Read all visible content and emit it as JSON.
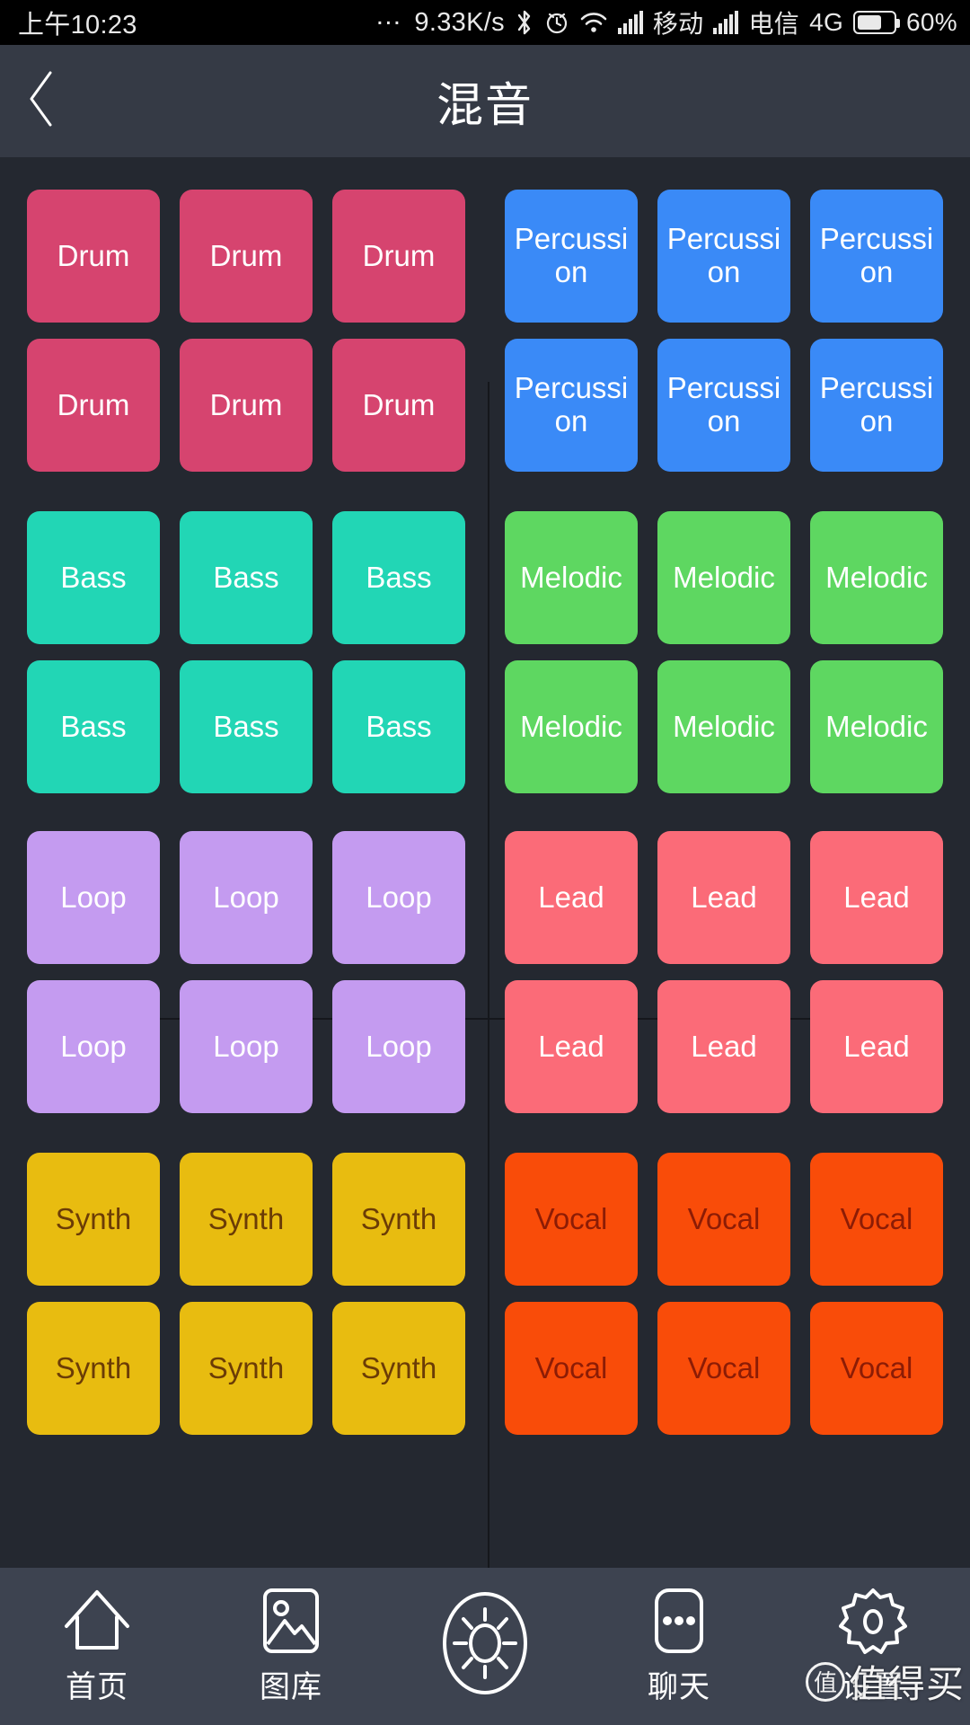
{
  "status_bar": {
    "time": "上午10:23",
    "dots": "…",
    "network_speed": "9.33K/s",
    "bluetooth_icon": "bluetooth-icon",
    "alarm_icon": "alarm-icon",
    "wifi_icon": "wifi-icon",
    "signal1_icon": "signal-bars-icon",
    "carrier1": "移动",
    "signal2_icon": "signal-bars-icon",
    "carrier2": "电信",
    "network_type": "4G",
    "battery_icon": "battery-icon",
    "battery_percent": "60%"
  },
  "title_bar": {
    "back_icon": "back-chevron-icon",
    "title": "混音"
  },
  "colors": {
    "background": "#242830",
    "title_bar": "#353A45",
    "nav_bar": "#3D4350",
    "divider": "#15171c",
    "drum": "#D6446F",
    "percussion": "#3A8AF7",
    "bass": "#22D6B5",
    "melodic": "#5ED761",
    "loop": "#C49BF0",
    "lead": "#FB6B78",
    "synth": "#E8BC10",
    "vocal": "#F94C09",
    "synth_text": "#6B3C06",
    "vocal_text": "#8C1C05",
    "pad_text": "#FFFFFF"
  },
  "pad_groups": [
    {
      "name": "drum",
      "side": "left",
      "color": "#D6446F",
      "text_color": "#FFFFFF",
      "rows": [
        [
          "Drum",
          "Drum",
          "Drum"
        ],
        [
          "Drum",
          "Drum",
          "Drum"
        ]
      ]
    },
    {
      "name": "percussion",
      "side": "right",
      "color": "#3A8AF7",
      "text_color": "#FFFFFF",
      "rows": [
        [
          "Percussion",
          "Percussion",
          "Percussion"
        ],
        [
          "Percussion",
          "Percussion",
          "Percussion"
        ]
      ]
    },
    {
      "name": "bass",
      "side": "left",
      "color": "#22D6B5",
      "text_color": "#FFFFFF",
      "rows": [
        [
          "Bass",
          "Bass",
          "Bass"
        ],
        [
          "Bass",
          "Bass",
          "Bass"
        ]
      ]
    },
    {
      "name": "melodic",
      "side": "right",
      "color": "#5ED761",
      "text_color": "#FFFFFF",
      "rows": [
        [
          "Melodic",
          "Melodic",
          "Melodic"
        ],
        [
          "Melodic",
          "Melodic",
          "Melodic"
        ]
      ]
    },
    {
      "name": "loop",
      "side": "left",
      "color": "#C49BF0",
      "text_color": "#FFFFFF",
      "rows": [
        [
          "Loop",
          "Loop",
          "Loop"
        ],
        [
          "Loop",
          "Loop",
          "Loop"
        ]
      ]
    },
    {
      "name": "lead",
      "side": "right",
      "color": "#FB6B78",
      "text_color": "#FFFFFF",
      "rows": [
        [
          "Lead",
          "Lead",
          "Lead"
        ],
        [
          "Lead",
          "Lead",
          "Lead"
        ]
      ]
    },
    {
      "name": "synth",
      "side": "left",
      "color": "#E8BC10",
      "text_color": "#6B3C06",
      "rows": [
        [
          "Synth",
          "Synth",
          "Synth"
        ],
        [
          "Synth",
          "Synth",
          "Synth"
        ]
      ]
    },
    {
      "name": "vocal",
      "side": "right",
      "color": "#F94C09",
      "text_color": "#8C1C05",
      "rows": [
        [
          "Vocal",
          "Vocal",
          "Vocal"
        ],
        [
          "Vocal",
          "Vocal",
          "Vocal"
        ]
      ]
    }
  ],
  "bottom_nav": [
    {
      "icon": "home-icon",
      "label": "首页"
    },
    {
      "icon": "gallery-icon",
      "label": "图库"
    },
    {
      "icon": "brightness-sun-icon",
      "label": ""
    },
    {
      "icon": "more-dots-icon",
      "label": "聊天"
    },
    {
      "icon": "gear-icon",
      "label": "设置"
    }
  ],
  "watermark": {
    "logo": "值",
    "text": "值得买"
  }
}
